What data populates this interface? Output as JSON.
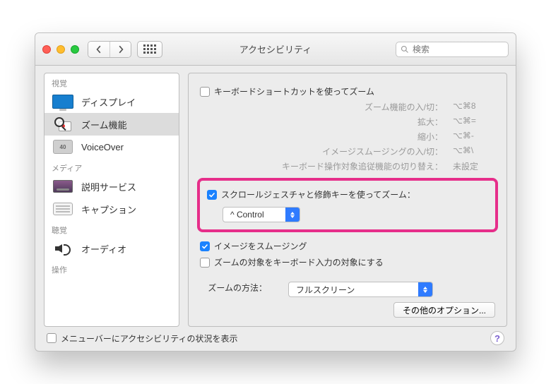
{
  "window_title": "アクセシビリティ",
  "search": {
    "placeholder": "検索"
  },
  "sidebar": {
    "sections": [
      {
        "header": "視覚",
        "items": [
          {
            "id": "display",
            "label": "ディスプレイ",
            "selected": false
          },
          {
            "id": "zoom",
            "label": "ズーム機能",
            "selected": true
          },
          {
            "id": "voiceover",
            "label": "VoiceOver",
            "selected": false
          }
        ]
      },
      {
        "header": "メディア",
        "items": [
          {
            "id": "descriptions",
            "label": "説明サービス",
            "selected": false
          },
          {
            "id": "captions",
            "label": "キャプション",
            "selected": false
          }
        ]
      },
      {
        "header": "聴覚",
        "items": [
          {
            "id": "audio",
            "label": "オーディオ",
            "selected": false
          }
        ]
      },
      {
        "header": "操作",
        "items": []
      }
    ]
  },
  "pane": {
    "kb_shortcut_label": "キーボードショートカットを使ってズーム",
    "shortcuts": [
      {
        "k": "ズーム機能の入/切：",
        "v": "⌥⌘8"
      },
      {
        "k": "拡大：",
        "v": "⌥⌘="
      },
      {
        "k": "縮小：",
        "v": "⌥⌘-"
      },
      {
        "k": "イメージスムージングの入/切：",
        "v": "⌥⌘\\"
      },
      {
        "k": "キーボード操作対象追従機能の切り替え：",
        "v": "未設定"
      }
    ],
    "scroll_zoom_label": "スクロールジェスチャと修飾キーを使ってズーム：",
    "modifier_select": "^ Control",
    "smooth_images_label": "イメージをスムージング",
    "keyboard_target_label": "ズームの対象をキーボード入力の対象にする",
    "zoom_style_label": "ズームの方法：",
    "zoom_style_value": "フルスクリーン",
    "more_options_button": "その他のオプション..."
  },
  "footer": {
    "menubar_status_label": "メニューバーにアクセシビリティの状況を表示"
  },
  "icons": {
    "voiceover_abbrev": "40"
  }
}
